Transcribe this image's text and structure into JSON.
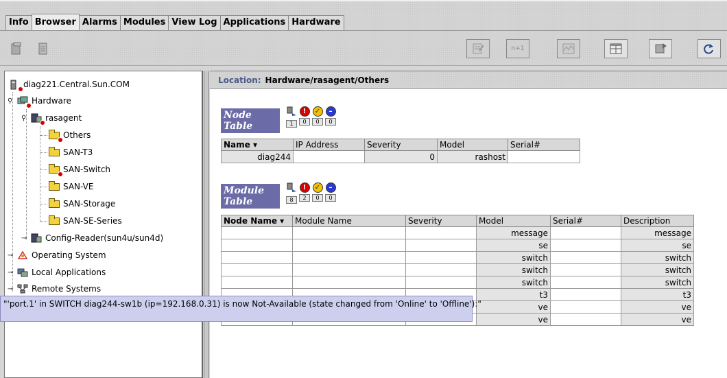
{
  "tabs": [
    "Info",
    "Browser",
    "Alarms",
    "Modules",
    "View Log",
    "Applications",
    "Hardware"
  ],
  "active_tab": "Browser",
  "toolbar": {
    "buttons": [
      {
        "icon": "details-icon",
        "label": ""
      },
      {
        "icon": "n-1-icon",
        "label": "n+1"
      },
      {
        "icon": "graph-icon",
        "label": ""
      },
      {
        "icon": "table-view-icon",
        "label": ""
      },
      {
        "icon": "sync-icon",
        "label": ""
      },
      {
        "icon": "refresh-icon",
        "label": "↻"
      }
    ]
  },
  "tree": {
    "root": "diag221.Central.Sun.COM",
    "items": [
      {
        "label": "Hardware"
      },
      {
        "label": "rasagent"
      },
      {
        "label": "Others"
      },
      {
        "label": "SAN-T3"
      },
      {
        "label": "SAN-Switch"
      },
      {
        "label": "SAN-VE"
      },
      {
        "label": "SAN-Storage"
      },
      {
        "label": "SAN-SE-Series"
      },
      {
        "label": "Config-Reader(sun4u/sun4d)"
      },
      {
        "label": "Operating System"
      },
      {
        "label": "Local Applications"
      },
      {
        "label": "Remote Systems"
      }
    ]
  },
  "location": {
    "label": "Location:",
    "path": "Hardware/rasagent/Others"
  },
  "node_table": {
    "title": "Node Table",
    "alarm_counts": [
      "1",
      "0",
      "0",
      "0"
    ],
    "columns": [
      "Name ▾",
      "IP Address",
      "Severity",
      "Model",
      "Serial#"
    ],
    "rows": [
      [
        "diag244",
        "",
        "0",
        "rashost",
        ""
      ]
    ]
  },
  "module_table": {
    "title": "Module Table",
    "alarm_counts": [
      "8",
      "2",
      "0",
      "0"
    ],
    "columns": [
      "Node Name ▾",
      "Module Name",
      "Severity",
      "Model",
      "Serial#",
      "Description"
    ],
    "rows": [
      [
        "",
        "",
        "",
        "message",
        "",
        "message"
      ],
      [
        "",
        "",
        "",
        "se",
        "",
        "se"
      ],
      [
        "",
        "",
        "",
        "switch",
        "",
        "switch"
      ],
      [
        "",
        "",
        "",
        "switch",
        "",
        "switch"
      ],
      [
        "",
        "",
        "",
        "switch",
        "",
        "switch"
      ],
      [
        "",
        "",
        "",
        "t3",
        "",
        "t3"
      ],
      [
        "",
        "",
        "",
        "ve",
        "",
        "ve"
      ],
      [
        "",
        "",
        "",
        "ve",
        "",
        "ve"
      ]
    ]
  },
  "tooltip": "\"'port.1' in SWITCH diag244-sw1b (ip=192.168.0.31) is now Not-Available (state changed from 'Online' to 'Offline'):\""
}
